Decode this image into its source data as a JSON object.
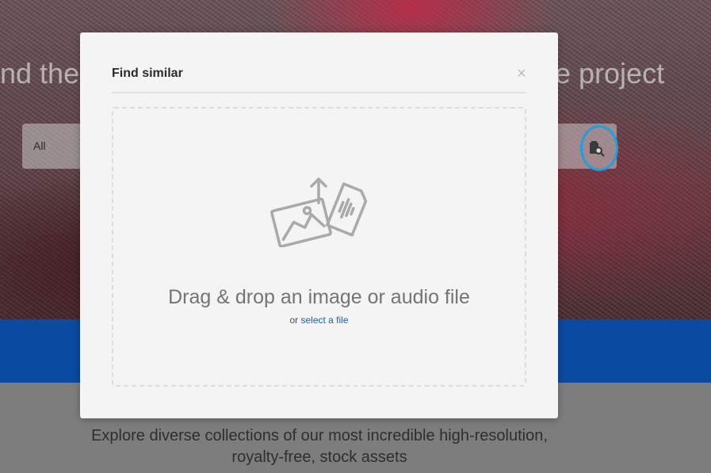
{
  "hero": {
    "headline_left": "nd the",
    "headline_right": "e project",
    "search_scope": "All"
  },
  "footer": {
    "explore_line1": "Explore diverse collections of our most incredible high-resolution,",
    "explore_line2": "royalty-free, stock assets"
  },
  "modal": {
    "title": "Find similar",
    "close_label": "×",
    "drop_text": "Drag & drop an image or audio file",
    "or_text": "or",
    "select_link": "select a file"
  },
  "colors": {
    "accent_blue": "#1c5fb3",
    "highlight_ring": "#1b9ee2",
    "band_blue": "#0a4aa0",
    "modal_bg": "#f4f4f4"
  },
  "icons": {
    "visual_search": "visual-search-icon",
    "upload": "upload-media-icon",
    "close": "close-icon"
  }
}
